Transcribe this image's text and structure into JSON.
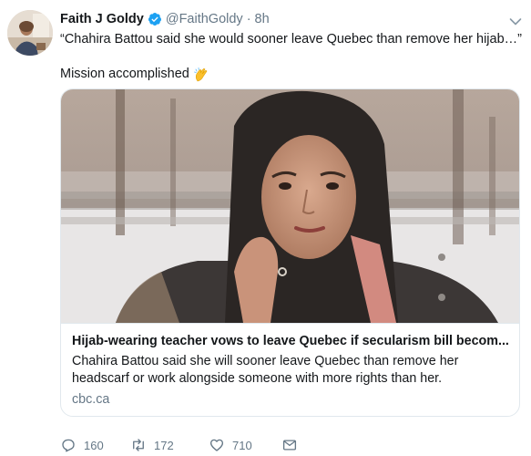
{
  "author": {
    "name": "Faith J Goldy",
    "handle": "@FaithGoldy",
    "time": "8h",
    "verified_icon": "verified-badge-icon"
  },
  "tweet": {
    "line1": "“Chahira Battou said she would sooner leave Quebec than remove her hijab…”",
    "line2": "Mission accomplished",
    "emoji_icon": "clapping-hands-icon"
  },
  "card": {
    "title": "Hijab-wearing teacher vows to leave Quebec if secularism bill becom...",
    "description_line1": "Chahira Battou said she will sooner leave Quebec than remove her",
    "description_line2": "headscarf or work alongside someone with more rights than her.",
    "domain": "cbc.ca"
  },
  "actions": {
    "replies": "160",
    "retweets": "172",
    "likes": "710"
  },
  "colors": {
    "accent": "#1da1f2",
    "secondary_text": "#657786",
    "border": "#e1e8ed"
  }
}
